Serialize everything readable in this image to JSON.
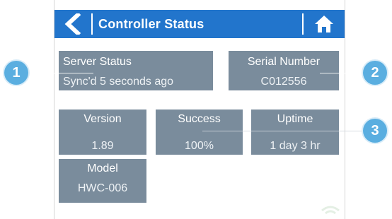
{
  "header": {
    "title": "Controller Status",
    "back_icon": "chevron-left-icon",
    "home_icon": "home-icon",
    "color": "#2275cc"
  },
  "tiles": {
    "server_status": {
      "label": "Server Status",
      "value": "Sync'd 5 seconds ago"
    },
    "serial_number": {
      "label": "Serial Number",
      "value": "C012556"
    },
    "version": {
      "label": "Version",
      "value": "1.89"
    },
    "success": {
      "label": "Success",
      "value": "100%"
    },
    "uptime": {
      "label": "Uptime",
      "value": "1 day 3 hr"
    },
    "model": {
      "label": "Model",
      "value": "HWC-006"
    }
  },
  "callouts": [
    "1",
    "2",
    "3"
  ],
  "colors": {
    "tile": "#7a8c9c",
    "callout": "#5aaee0"
  }
}
